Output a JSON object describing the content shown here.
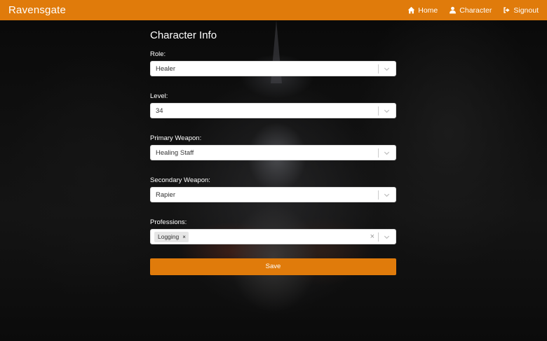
{
  "app": {
    "brand": "Ravensgate"
  },
  "nav": {
    "home": {
      "label": "Home",
      "icon": "home-icon"
    },
    "character": {
      "label": "Character",
      "icon": "user-icon"
    },
    "signout": {
      "label": "Signout",
      "icon": "sign-out-icon"
    }
  },
  "form": {
    "title": "Character Info",
    "role": {
      "label": "Role:",
      "value": "Healer"
    },
    "level": {
      "label": "Level:",
      "value": "34"
    },
    "primary_weapon": {
      "label": "Primary Weapon:",
      "value": "Healing Staff"
    },
    "secondary_weapon": {
      "label": "Secondary Weapon:",
      "value": "Rapier"
    },
    "professions": {
      "label": "Professions:",
      "tags": [
        "Logging"
      ],
      "tag_remove": "×",
      "clear": "×"
    },
    "save_label": "Save"
  },
  "colors": {
    "accent": "#e07b0b"
  }
}
